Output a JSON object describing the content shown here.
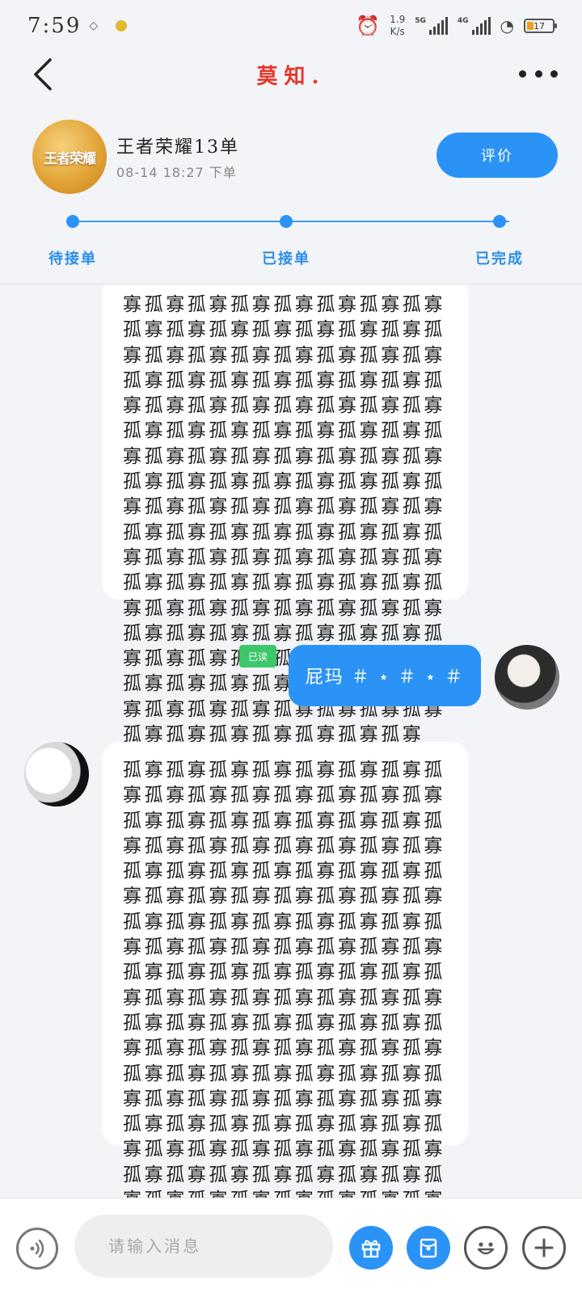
{
  "status_bar": {
    "time": "7:59",
    "net_speed_value": "1.9",
    "net_speed_unit": "K/s",
    "signal1_label": "5G",
    "signal2_label": "4G",
    "battery": "17"
  },
  "header": {
    "title": "莫知.",
    "back_icon": "chevron-left-icon",
    "more_icon": "more-dots-icon"
  },
  "order": {
    "title": "王者荣耀13单",
    "time": "08-14 18:27 下单",
    "logo_text": "王者荣耀",
    "rate_button": "评价",
    "steps": [
      "待接单",
      "已接单",
      "已完成"
    ],
    "accent_color": "#2b93f5"
  },
  "messages": [
    {
      "side": "left",
      "text": "寡孤寡孤寡孤寡孤寡孤寡孤寡孤寡孤寡孤寡孤寡孤寡孤寡孤寡孤寡孤寡孤寡孤寡孤寡孤寡孤寡孤寡孤寡孤寡孤寡孤寡孤寡孤寡孤寡孤寡孤寡孤寡孤寡孤寡孤寡孤寡孤寡孤寡孤寡孤寡孤寡孤寡孤寡孤寡孤寡孤寡孤寡孤寡孤寡孤寡孤寡孤寡孤寡孤寡孤寡孤寡孤寡孤寡孤寡孤寡孤寡孤寡孤寡孤寡孤寡孤寡孤寡孤寡孤寡孤寡孤寡孤寡孤寡孤寡孤寡孤寡孤寡孤寡孤寡孤寡孤寡孤寡孤寡孤寡孤寡孤寡孤寡孤寡孤寡孤寡孤寡孤寡孤寡孤寡孤寡孤寡孤寡孤寡孤寡孤寡孤寡孤寡孤寡孤寡孤寡孤寡孤寡孤寡孤寡孤寡孤寡孤寡孤寡孤寡孤寡孤寡孤寡孤寡孤寡孤寡孤寡孤寡孤寡孤寡孤寡孤寡孤寡孤寡孤寡孤寡孤寡孤寡孤寡孤寡孤寡"
    },
    {
      "side": "right",
      "text": "屁玛 ＃ ⋆ ＃ ⋆ ＃",
      "read_badge": "已读"
    },
    {
      "side": "left",
      "text": "孤寡孤寡孤寡孤寡孤寡孤寡孤寡孤寡孤寡孤寡孤寡孤寡孤寡孤寡孤寡孤寡孤寡孤寡孤寡孤寡孤寡孤寡孤寡孤寡孤寡孤寡孤寡孤寡孤寡孤寡孤寡孤寡孤寡孤寡孤寡孤寡孤寡孤寡孤寡孤寡孤寡孤寡孤寡孤寡孤寡孤寡孤寡孤寡孤寡孤寡孤寡孤寡孤寡孤寡孤寡孤寡孤寡孤寡孤寡孤寡孤寡孤寡孤寡孤寡孤寡孤寡孤寡孤寡孤寡孤寡孤寡孤寡孤寡孤寡孤寡孤寡孤寡孤寡孤寡孤寡孤寡孤寡孤寡孤寡孤寡孤寡孤寡孤寡孤寡孤寡孤寡孤寡孤寡孤寡孤寡孤寡孤寡孤寡孤寡孤寡孤寡孤寡孤寡孤寡孤寡孤寡孤寡孤寡孤寡孤寡孤寡孤寡孤寡孤寡孤寡孤寡孤寡孤寡孤寡孤寡孤寡孤寡孤寡孤寡孤寡孤寡孤寡孤寡孤寡孤寡孤寡孤寡孤寡孤寡孤寡孤寡孤寡孤寡孤寡孤寡孤寡孤寡孤寡孤寡孤寡孤寡孤寡孤寡孤寡孤寡孤寡孤寡"
    }
  ],
  "input_bar": {
    "placeholder": "请输入消息",
    "voice_icon": "voice-icon",
    "gift_icon": "gift-icon",
    "red_packet_icon": "red-packet-icon",
    "emoji_icon": "emoji-icon",
    "plus_icon": "plus-icon"
  }
}
